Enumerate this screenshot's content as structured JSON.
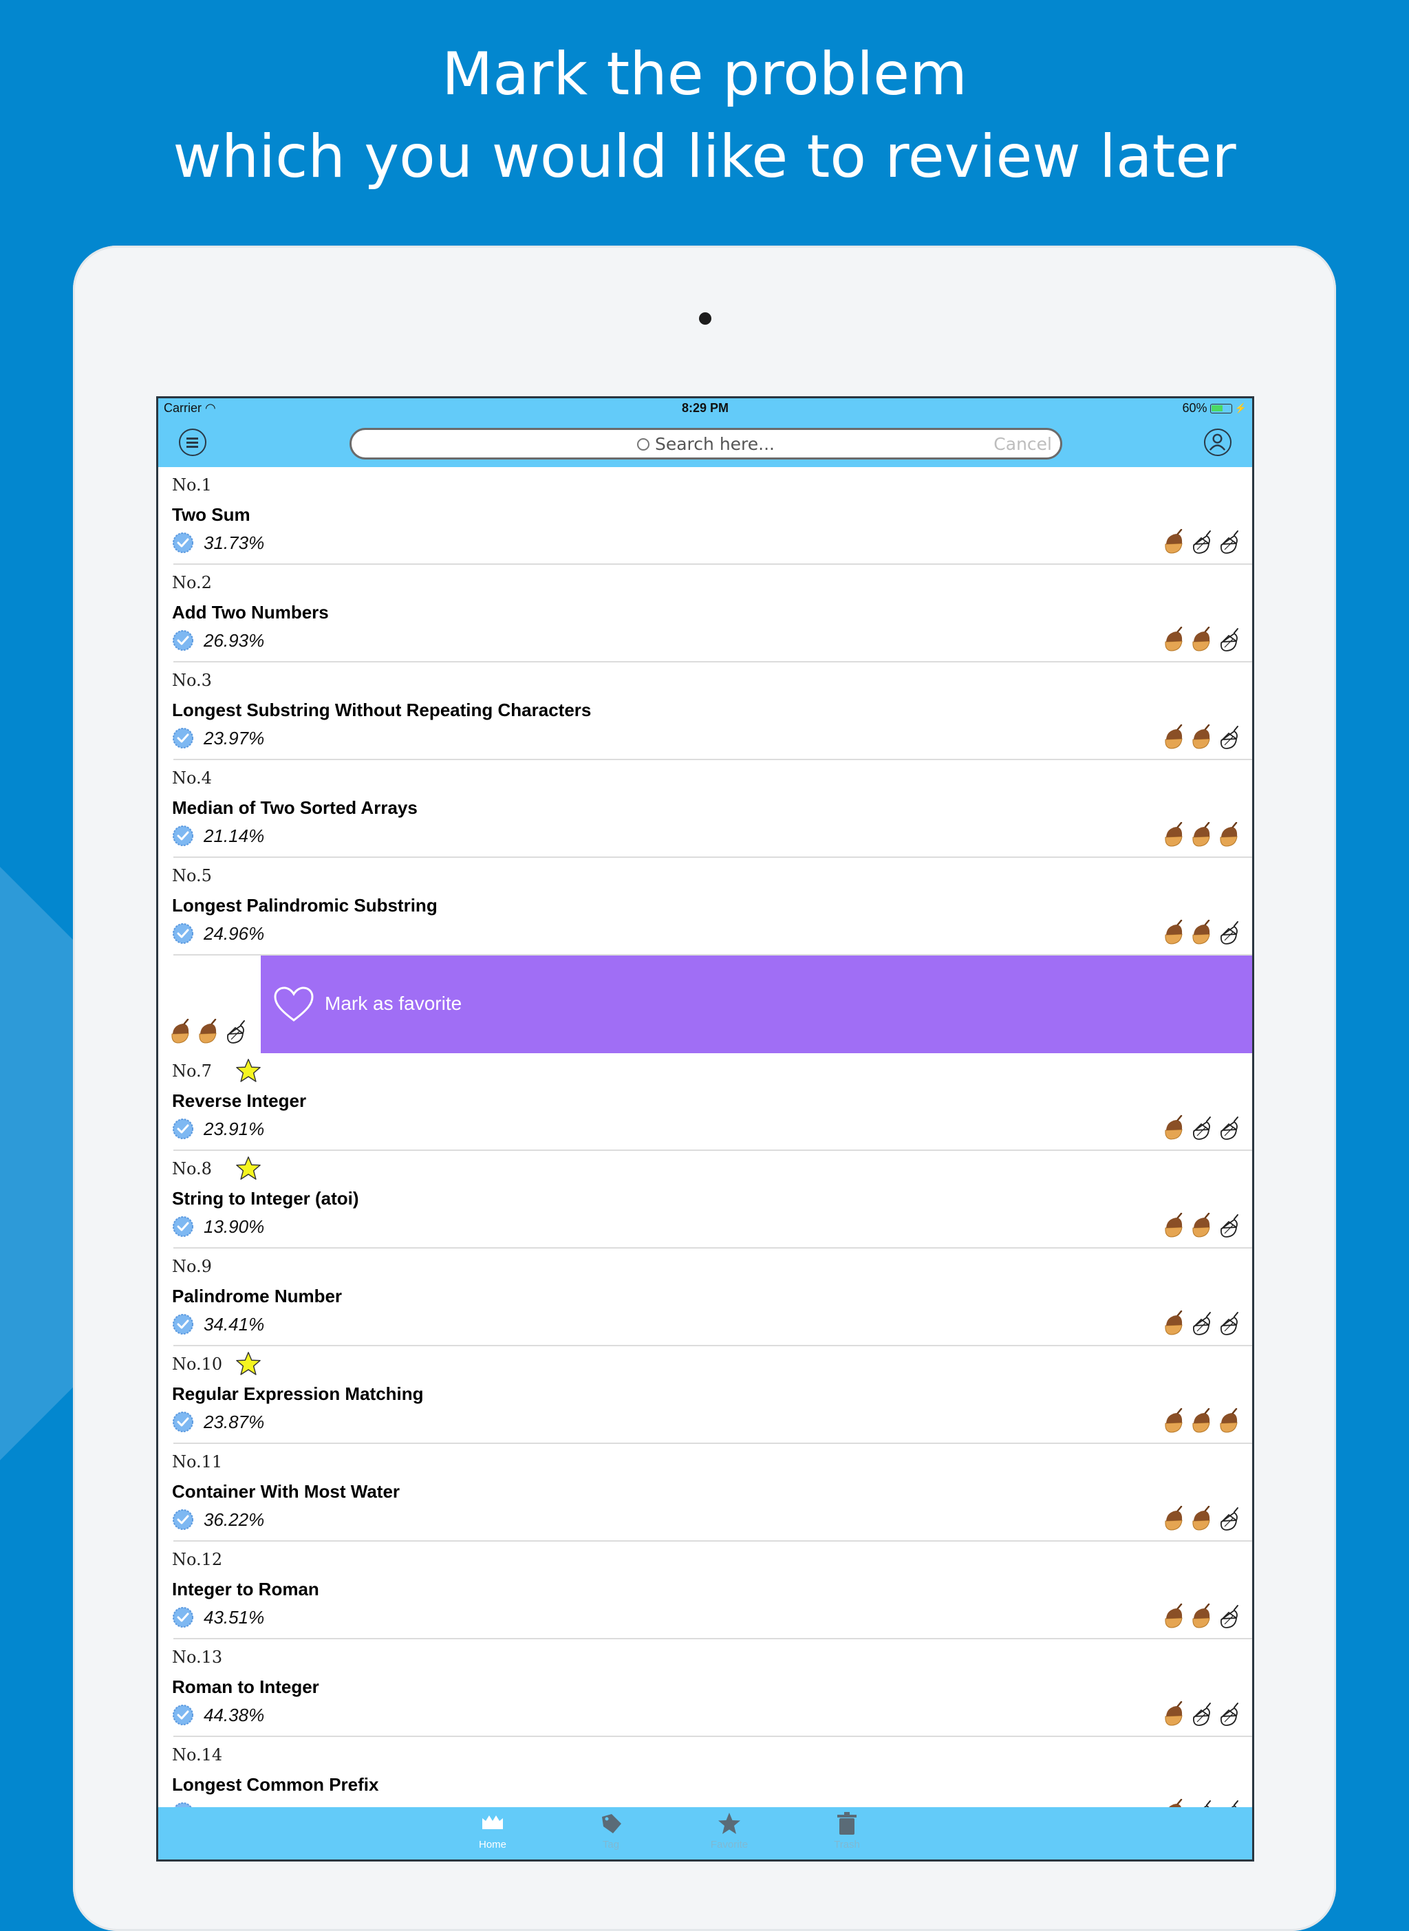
{
  "headline": {
    "line1": "Mark the problem",
    "line2": "which you would like to review later"
  },
  "status_bar": {
    "carrier": "Carrier",
    "time": "8:29 PM",
    "battery": "60%",
    "battery_level": 0.6
  },
  "search": {
    "placeholder": "Search here...",
    "cancel_label": "Cancel"
  },
  "swipe_action": {
    "label": "Mark as favorite",
    "acorns": [
      "filled",
      "filled",
      "outline"
    ]
  },
  "problems": [
    {
      "number": "No.1",
      "title": "Two Sum",
      "rate": "31.73%",
      "favorite": false,
      "acorns": [
        "filled",
        "outline",
        "outline"
      ]
    },
    {
      "number": "No.2",
      "title": "Add Two Numbers",
      "rate": "26.93%",
      "favorite": false,
      "acorns": [
        "filled",
        "filled",
        "outline"
      ]
    },
    {
      "number": "No.3",
      "title": "Longest Substring Without Repeating Characters",
      "rate": "23.97%",
      "favorite": false,
      "acorns": [
        "filled",
        "filled",
        "outline"
      ]
    },
    {
      "number": "No.4",
      "title": "Median of Two Sorted Arrays",
      "rate": "21.14%",
      "favorite": false,
      "acorns": [
        "filled",
        "filled",
        "filled"
      ]
    },
    {
      "number": "No.5",
      "title": "Longest Palindromic Substring",
      "rate": "24.96%",
      "favorite": false,
      "acorns": [
        "filled",
        "filled",
        "outline"
      ]
    },
    {
      "number": "No.7",
      "title": "Reverse Integer",
      "rate": "23.91%",
      "favorite": true,
      "acorns": [
        "filled",
        "outline",
        "outline"
      ]
    },
    {
      "number": "No.8",
      "title": "String to Integer (atoi)",
      "rate": "13.90%",
      "favorite": true,
      "acorns": [
        "filled",
        "filled",
        "outline"
      ]
    },
    {
      "number": "No.9",
      "title": "Palindrome Number",
      "rate": "34.41%",
      "favorite": false,
      "acorns": [
        "filled",
        "outline",
        "outline"
      ]
    },
    {
      "number": "No.10",
      "title": "Regular Expression Matching",
      "rate": "23.87%",
      "favorite": true,
      "acorns": [
        "filled",
        "filled",
        "filled"
      ]
    },
    {
      "number": "No.11",
      "title": "Container With Most Water",
      "rate": "36.22%",
      "favorite": false,
      "acorns": [
        "filled",
        "filled",
        "outline"
      ]
    },
    {
      "number": "No.12",
      "title": "Integer to Roman",
      "rate": "43.51%",
      "favorite": false,
      "acorns": [
        "filled",
        "filled",
        "outline"
      ]
    },
    {
      "number": "No.13",
      "title": "Roman to Integer",
      "rate": "44.38%",
      "favorite": false,
      "acorns": [
        "filled",
        "outline",
        "outline"
      ]
    },
    {
      "number": "No.14",
      "title": "Longest Common Prefix",
      "rate": "",
      "favorite": false,
      "acorns": [
        "filled",
        "outline",
        "outline"
      ]
    }
  ],
  "tabs": [
    {
      "label": "Home",
      "icon": "home-icon",
      "active": true
    },
    {
      "label": "Tag",
      "icon": "tag-icon",
      "active": false
    },
    {
      "label": "Favorite",
      "icon": "star-icon",
      "active": false
    },
    {
      "label": "Trash",
      "icon": "trash-icon",
      "active": false
    }
  ],
  "colors": {
    "background": "#0387cf",
    "bar": "#63cbf9",
    "swipe_action": "#a06ef5",
    "star": "#f5f520",
    "check": "#7eb8f2"
  }
}
